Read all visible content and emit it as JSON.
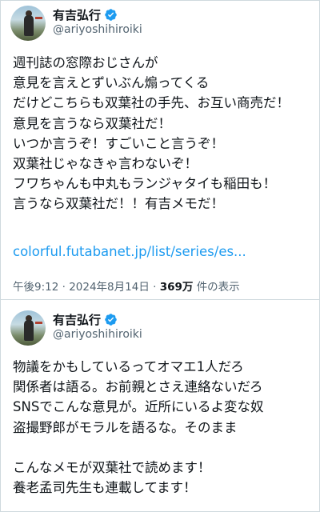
{
  "tweet1": {
    "author_name": "有吉弘行",
    "handle": "@ariyoshihiroiki",
    "lines": [
      "週刊誌の窓際おじさんが",
      "意見を言えとずいぶん煽ってくる",
      "だけどこちらも双葉社の手先、お互い商売だ！",
      "意見を言うなら双葉社だ！",
      "いつか言うぞ！すごいこと言うぞ！",
      "双葉社じゃなきゃ言わないぞ！",
      "フワちゃんも中丸もランジャタイも稲田も！",
      "言うなら双葉社だ！！有吉メモだ！"
    ],
    "link_text": "colorful.futabanet.jp/list/series/es...",
    "timestamp": "午後9:12 · 2024年8月14日 ·",
    "views_count": "369万",
    "views_label": "件の表示"
  },
  "tweet2": {
    "author_name": "有吉弘行",
    "handle": "@ariyoshihiroiki",
    "lines": [
      "物議をかもしているってオマエ1人だろ",
      "関係者は語る。お前親とさえ連絡ないだろ",
      "SNSでこんな意見が。近所にいるよ変な奴",
      "盗撮野郎がモラルを語るな。そのまま",
      "",
      "こんなメモが双葉社で読めます！",
      "養老孟司先生も連載してます！"
    ]
  },
  "colors": {
    "link": "#1d9bf0",
    "verified": "#1d9bf0",
    "secondary_text": "#536471",
    "primary_text": "#0f1419"
  },
  "icons": {
    "verified": "verified-badge-icon"
  }
}
